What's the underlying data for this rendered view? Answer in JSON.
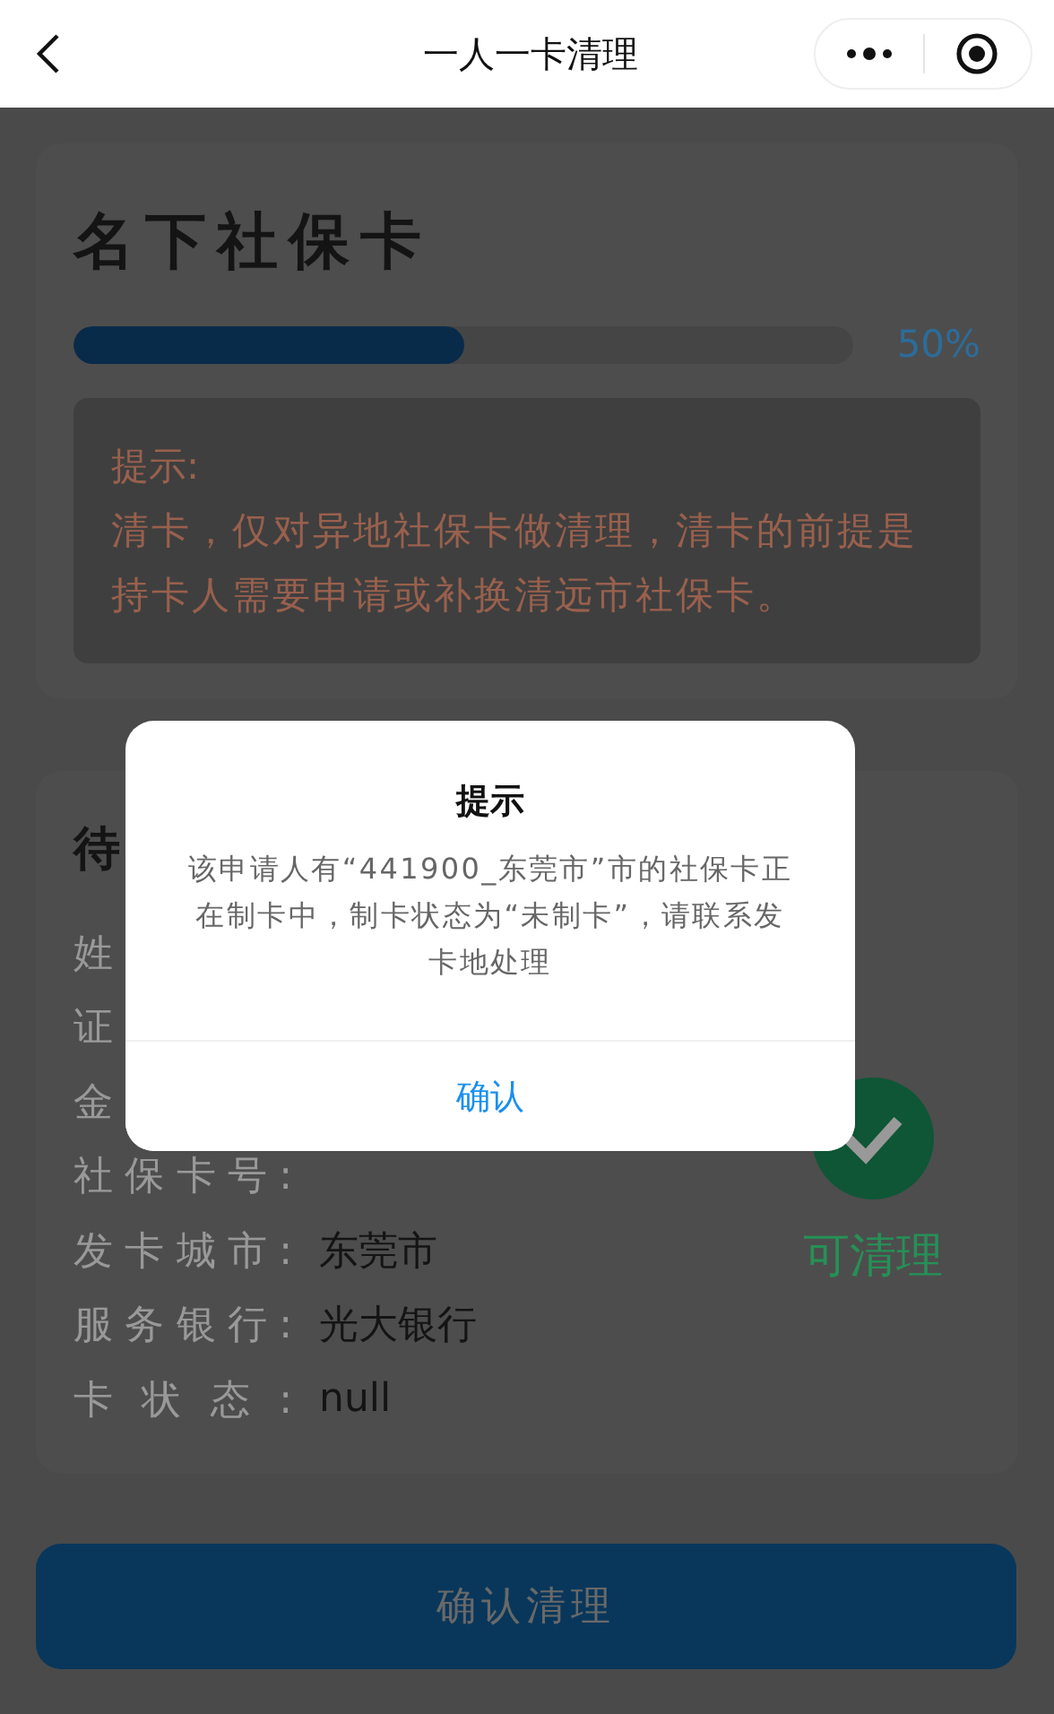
{
  "nav": {
    "title": "一人一卡清理"
  },
  "cards_section": {
    "title": "名下社保卡",
    "progress": {
      "level": 0.5,
      "reading": "50%"
    },
    "hint": {
      "heading": "提示:",
      "text": "清卡，仅对异地社保卡做清理，清卡的前提是持卡人需要申请或补换清远市社保卡。"
    }
  },
  "pending": {
    "title": "待",
    "fields": [
      {
        "label": "姓"
      },
      {
        "label": "证"
      },
      {
        "label": "金"
      },
      {
        "label": "社保卡号:"
      },
      {
        "label": "发卡城市:",
        "value": "东莞市"
      },
      {
        "label": "服务银行:",
        "value": "光大银行"
      },
      {
        "label": "卡状态:",
        "value": "null"
      }
    ],
    "status": "可清理"
  },
  "confirm_button": "确认清理",
  "dialog": {
    "title": "提示",
    "message": "该申请人有“441900_东莞市”市的社保卡正在制卡中，制卡状态为“未制卡”，请联系发卡地处理",
    "button": "确认"
  }
}
